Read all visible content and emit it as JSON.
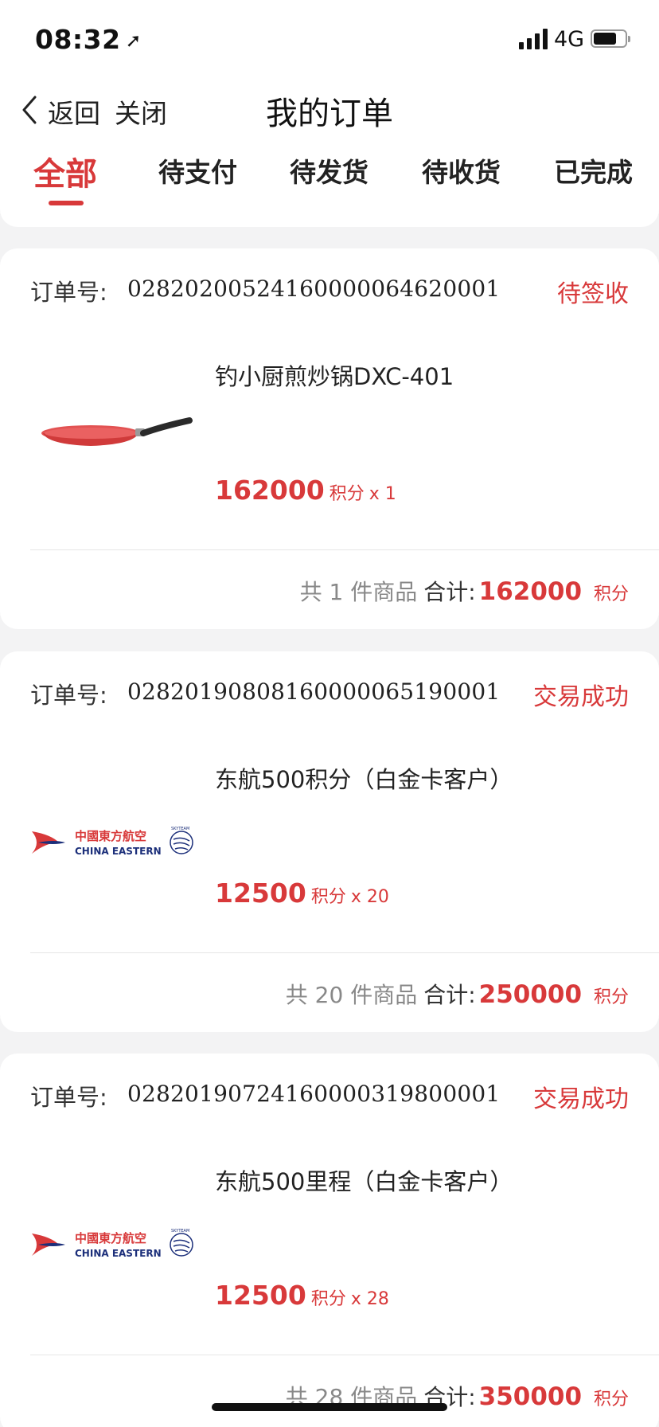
{
  "status_bar": {
    "time": "08:32",
    "location_icon": "location-arrow-icon",
    "network": "4G"
  },
  "header": {
    "back_label": "返回",
    "close_label": "关闭",
    "title": "我的订单",
    "tabs": [
      {
        "label": "全部",
        "active": true
      },
      {
        "label": "待支付"
      },
      {
        "label": "待发货"
      },
      {
        "label": "待收货"
      },
      {
        "label": "已完成"
      }
    ]
  },
  "orders": [
    {
      "order_label": "订单号:",
      "order_no": "02820200524160000064620001",
      "status": "待签收",
      "product_name": "钓小厨煎炒锅DXC-401",
      "price": "162000",
      "unit": "积分",
      "qty": "x 1",
      "summary_count": "共 1 件商品",
      "summary_label": "合计:",
      "summary_amount": "162000",
      "summary_unit": "积分",
      "image": "frying-pan"
    },
    {
      "order_label": "订单号:",
      "order_no": "02820190808160000065190001",
      "status": "交易成功",
      "product_name": "东航500积分（白金卡客户）",
      "price": "12500",
      "unit": "积分",
      "qty": "x 20",
      "summary_count": "共 20 件商品",
      "summary_label": "合计:",
      "summary_amount": "250000",
      "summary_unit": "积分",
      "image": "china-eastern-logo",
      "logo_text_cn": "中國東方航空",
      "logo_text_en": "CHINA EASTERN",
      "logo_text_skyteam": "SKYTEAM"
    },
    {
      "order_label": "订单号:",
      "order_no": "02820190724160000319800001",
      "status": "交易成功",
      "product_name": "东航500里程（白金卡客户）",
      "price": "12500",
      "unit": "积分",
      "qty": "x 28",
      "summary_count": "共 28 件商品",
      "summary_label": "合计:",
      "summary_amount": "350000",
      "summary_unit": "积分",
      "image": "china-eastern-logo",
      "logo_text_cn": "中國東方航空",
      "logo_text_en": "CHINA EASTERN",
      "logo_text_skyteam": "SKYTEAM"
    }
  ],
  "colors": {
    "accent": "#d8393a",
    "background": "#f3f3f4"
  }
}
